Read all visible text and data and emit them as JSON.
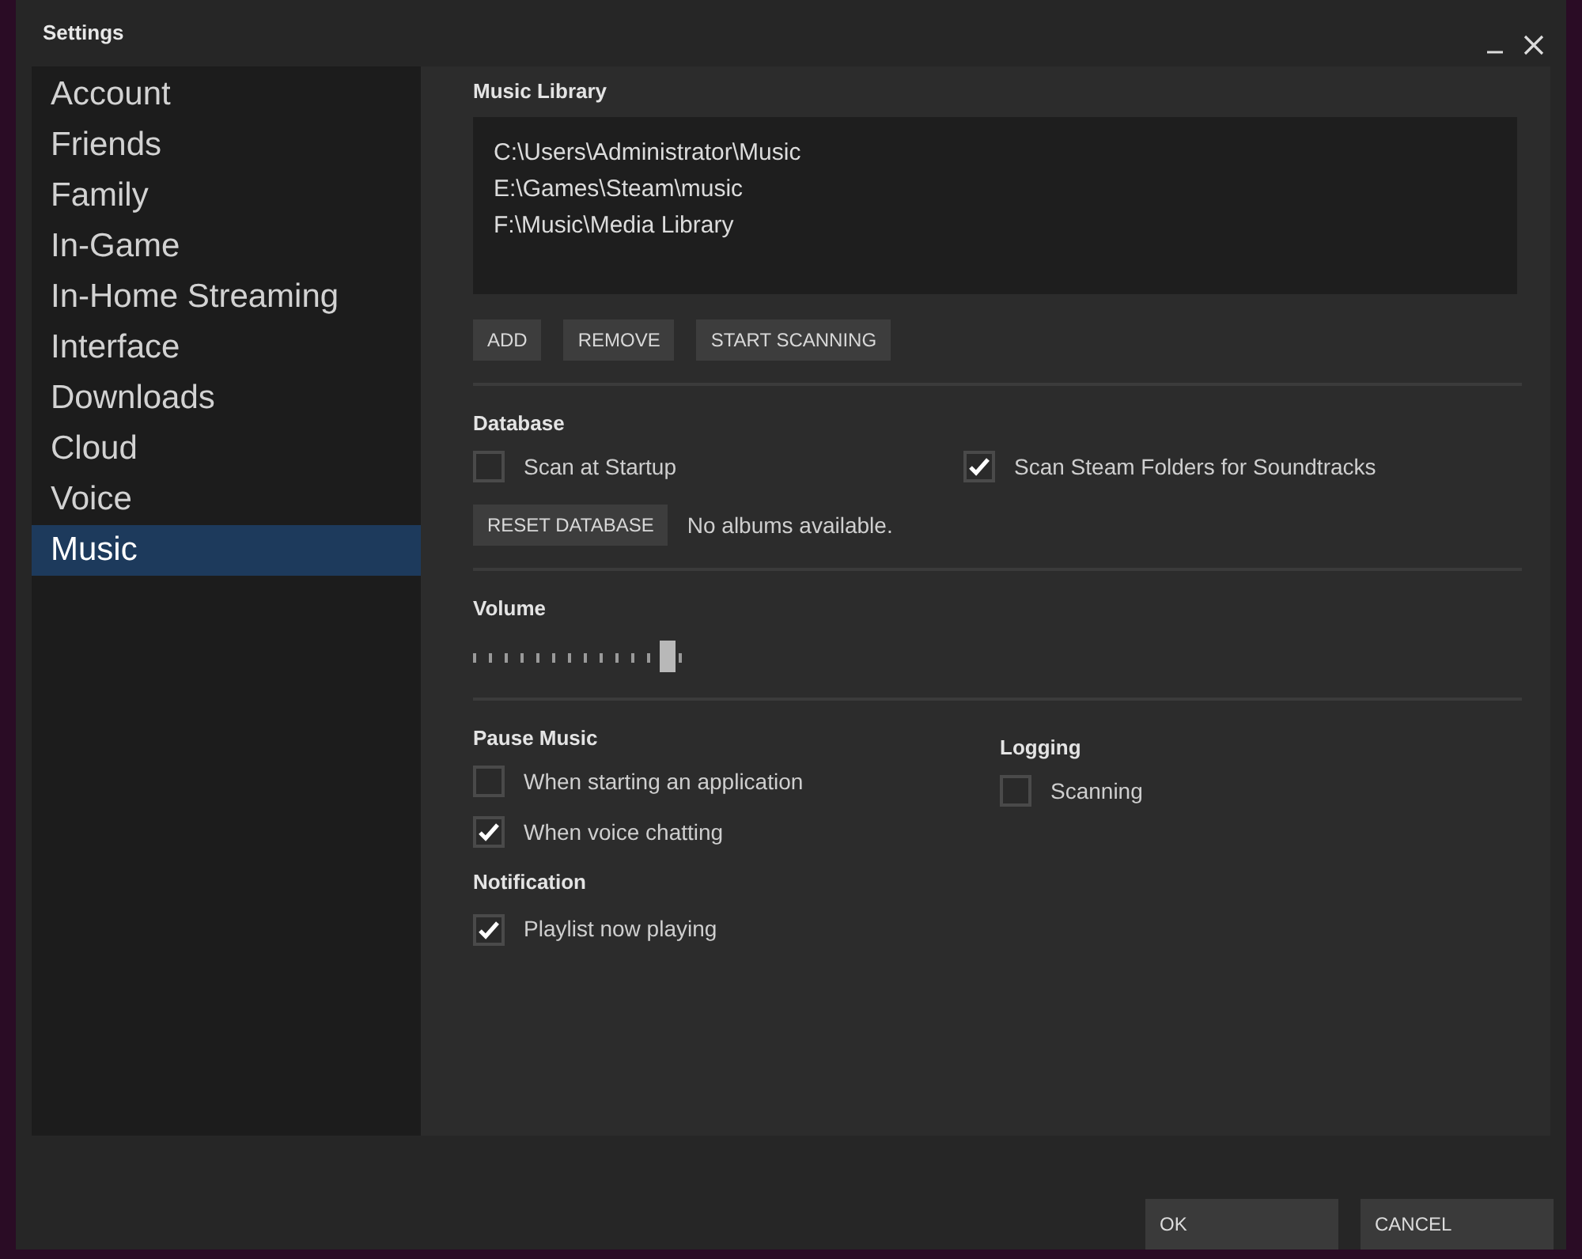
{
  "window": {
    "title": "Settings"
  },
  "sidebar": {
    "items": [
      {
        "label": "Account",
        "selected": false
      },
      {
        "label": "Friends",
        "selected": false
      },
      {
        "label": "Family",
        "selected": false
      },
      {
        "label": "In-Game",
        "selected": false
      },
      {
        "label": "In-Home Streaming",
        "selected": false
      },
      {
        "label": "Interface",
        "selected": false
      },
      {
        "label": "Downloads",
        "selected": false
      },
      {
        "label": "Cloud",
        "selected": false
      },
      {
        "label": "Voice",
        "selected": false
      },
      {
        "label": "Music",
        "selected": true
      }
    ]
  },
  "music_library": {
    "title": "Music Library",
    "folders": [
      "C:\\Users\\Administrator\\Music",
      "E:\\Games\\Steam\\music",
      "F:\\Music\\Media Library"
    ],
    "buttons": [
      "ADD",
      "REMOVE",
      "START SCANNING"
    ]
  },
  "database": {
    "title": "Database",
    "options": [
      {
        "label": "Scan at Startup",
        "checked": false
      },
      {
        "label": "Scan Steam Folders for Soundtracks",
        "checked": true
      }
    ],
    "reset_button": "RESET DATABASE",
    "status": "No albums available."
  },
  "volume": {
    "title": "Volume",
    "level": 1
  },
  "pause_music": {
    "title": "Pause Music",
    "options": [
      {
        "label": "When starting an application",
        "checked": false
      },
      {
        "label": "When voice chatting",
        "checked": true
      }
    ]
  },
  "logging": {
    "title": "Logging",
    "options": [
      {
        "label": "Scanning",
        "checked": false
      }
    ]
  },
  "notification": {
    "title": "Notification",
    "options": [
      {
        "label": "Playlist now playing",
        "checked": true
      }
    ]
  },
  "footer": {
    "buttons": [
      "OK",
      "CANCEL"
    ]
  }
}
